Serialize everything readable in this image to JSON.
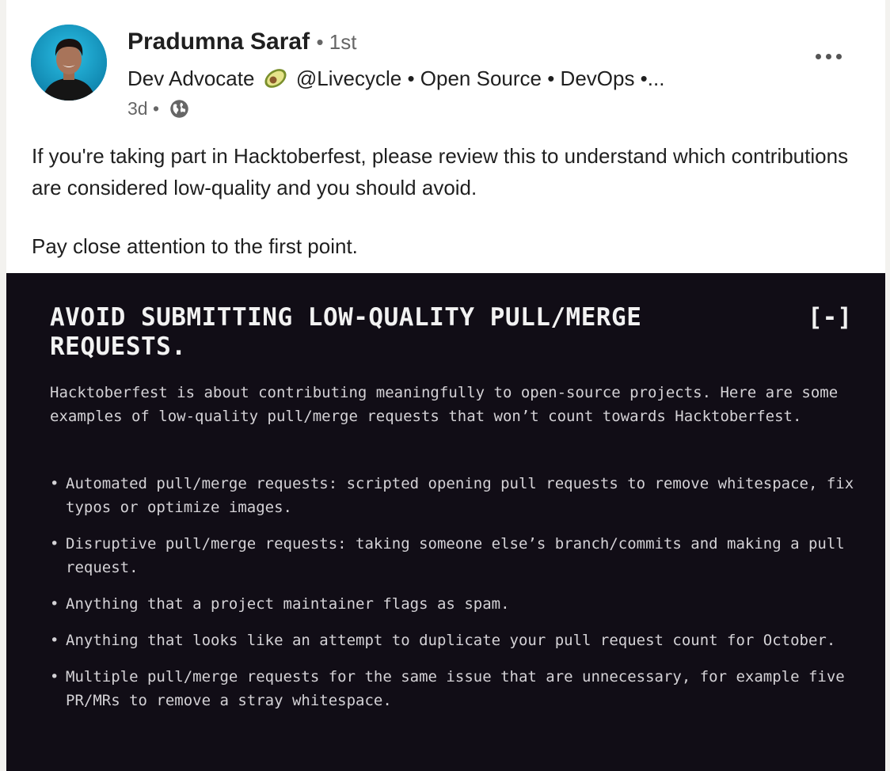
{
  "post": {
    "author": {
      "name": "Pradumna Saraf",
      "degree": "• 1st",
      "headline_pre": "Dev Advocate",
      "headline_post": "@Livecycle • Open Source • DevOps •...",
      "time": "3d •"
    },
    "icons": {
      "avatar": "profile-photo",
      "headline_emoji": "avocado-icon",
      "visibility": "globe-icon",
      "menu": "more-options-icon"
    },
    "text": {
      "line1": "If you're taking part in Hacktoberfest, please review this to understand which contributions are considered low-quality and you should avoid.",
      "line2": "Pay close attention to the first point."
    }
  },
  "image": {
    "title": "AVOID SUBMITTING LOW-QUALITY PULL/MERGE REQUESTS.",
    "collapse_label": "[-]",
    "intro": "Hacktoberfest is about contributing meaningfully to open-source projects. Here are some examples of low-quality pull/merge requests that won’t count towards Hacktoberfest.",
    "bullet": "•",
    "items": [
      "Automated pull/merge requests: scripted opening pull requests to remove whitespace, fix typos or optimize images.",
      "Disruptive pull/merge requests: taking someone else’s branch/commits and making a pull request.",
      "Anything that a project maintainer flags as spam.",
      "Anything that looks like an attempt to duplicate your pull request count for October.",
      "Multiple pull/merge requests for the same issue that are unnecessary, for example five PR/MRs to remove a stray whitespace."
    ]
  },
  "colors": {
    "image_background": "#110d16",
    "image_text": "#d4d2d6",
    "title_text": "#f2f2f2",
    "secondary_text": "#666666"
  }
}
